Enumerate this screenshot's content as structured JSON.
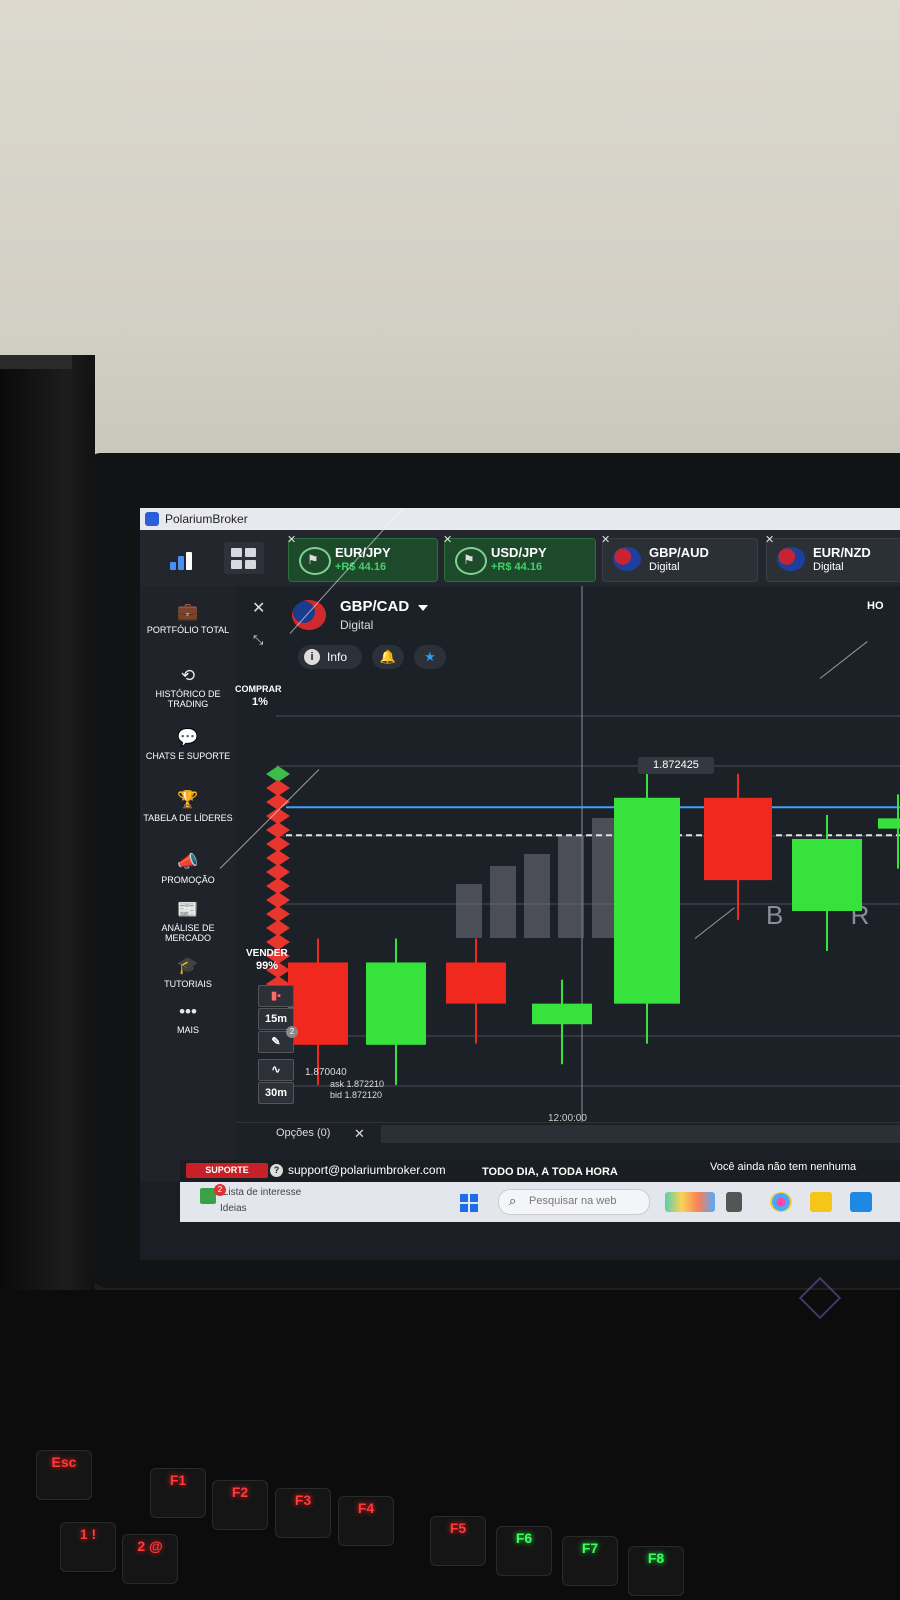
{
  "window": {
    "title": "PolariumBroker"
  },
  "tabs": [
    {
      "pair": "EUR/JPY",
      "sub": "+R$ 44.16",
      "active": true
    },
    {
      "pair": "USD/JPY",
      "sub": "+R$ 44.16",
      "active": true
    },
    {
      "pair": "GBP/AUD",
      "sub": "Digital",
      "active": false
    },
    {
      "pair": "EUR/NZD",
      "sub": "Digital",
      "active": false
    }
  ],
  "sidebar": {
    "items": [
      {
        "label": "PORTFÓLIO TOTAL",
        "icon": "briefcase-icon"
      },
      {
        "label": "HISTÓRICO DE TRADING",
        "icon": "history-icon"
      },
      {
        "label": "CHATS E SUPORTE",
        "icon": "chat-icon"
      },
      {
        "label": "TABELA DE LÍDERES",
        "icon": "trophy-icon"
      },
      {
        "label": "PROMOÇÃO",
        "icon": "megaphone-icon"
      },
      {
        "label": "ANÁLISE DE MERCADO",
        "icon": "news-icon"
      },
      {
        "label": "TUTORIAIS",
        "icon": "graduation-cap-icon"
      },
      {
        "label": "MAIS",
        "icon": "more-icon"
      }
    ]
  },
  "asset": {
    "pair": "GBP/CAD",
    "type": "Digital",
    "info_label": "Info",
    "right_clipped": "HO"
  },
  "sentiment": {
    "buy_label": "COMPRAR",
    "buy_pct": "1%",
    "sell_label": "VENDER",
    "sell_pct": "99%"
  },
  "tools": {
    "timeframe_1": "15m",
    "timeframe_2": "30m",
    "drawing_badge": "2"
  },
  "chart": {
    "current_price": "1.872425",
    "low_price": "1.870040",
    "ask": "ask 1.872210",
    "bid": "bid 1.872120",
    "time_label": "12:00:00",
    "watermark": "B R"
  },
  "chart_data": {
    "type": "candlestick",
    "candles": [
      {
        "dir": "down",
        "open": 1.8708,
        "close": 1.87
      },
      {
        "dir": "up",
        "open": 1.87,
        "close": 1.8708
      },
      {
        "dir": "down",
        "open": 1.8708,
        "close": 1.8704
      },
      {
        "dir": "up",
        "open": 1.8702,
        "close": 1.8704
      },
      {
        "dir": "up",
        "open": 1.8704,
        "close": 1.8724
      },
      {
        "dir": "down",
        "open": 1.8724,
        "close": 1.8716
      },
      {
        "dir": "up",
        "open": 1.8713,
        "close": 1.872
      },
      {
        "dir": "up",
        "open": 1.8721,
        "close": 1.8722
      }
    ],
    "current_price": 1.872425,
    "low_label": 1.87004
  },
  "options_bar": {
    "label": "Opções (0)"
  },
  "status_bar": {
    "support_label": "SUPORTE",
    "email": "support@polariumbroker.com",
    "hours": "TODO DIA, A TODA HORA",
    "no_trades": "Você ainda não tem nenhuma"
  },
  "taskbar": {
    "widget_title": "Lista de interesse",
    "widget_sub": "Ideias",
    "widget_badge": "2",
    "search_placeholder": "Pesquisar na web"
  },
  "keyboard": {
    "keys": [
      "Esc",
      "F1",
      "F2",
      "F3",
      "F4",
      "F5",
      "F6",
      "F7",
      "F8"
    ],
    "lower_keys": [
      "1 !",
      "2 @"
    ]
  }
}
